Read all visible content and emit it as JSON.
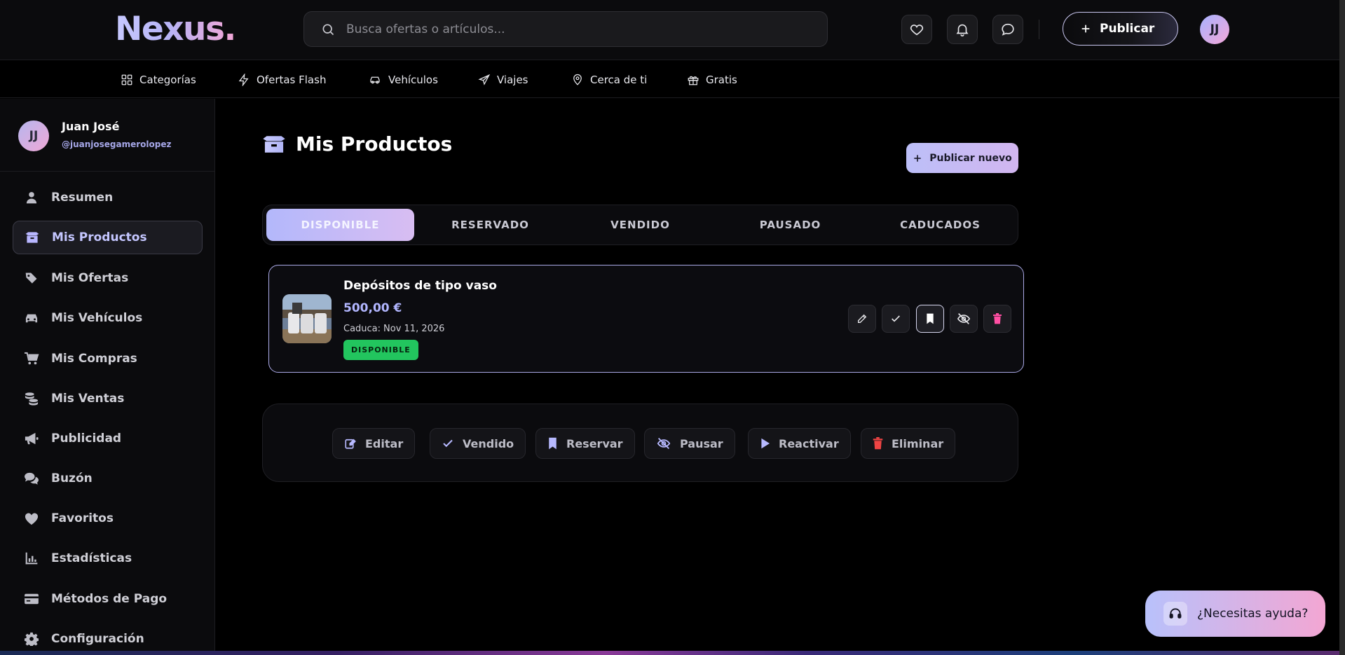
{
  "brand": {
    "logo": "Nexus."
  },
  "search": {
    "placeholder": "Busca ofertas o artículos..."
  },
  "header": {
    "publish_label": "Publicar",
    "avatar_initials": "JJ"
  },
  "categories": [
    {
      "label": "Categorías",
      "icon": "grid-icon"
    },
    {
      "label": "Ofertas Flash",
      "icon": "lightning-icon"
    },
    {
      "label": "Vehículos",
      "icon": "car-icon"
    },
    {
      "label": "Viajes",
      "icon": "plane-icon"
    },
    {
      "label": "Cerca de ti",
      "icon": "map-pin-icon"
    },
    {
      "label": "Gratis",
      "icon": "gift-icon"
    }
  ],
  "sidebar": {
    "user": {
      "initials": "JJ",
      "name": "Juan José",
      "handle": "@juanjosegamerolopez"
    },
    "items": [
      {
        "label": "Resumen",
        "icon": "user-icon"
      },
      {
        "label": "Mis Productos",
        "icon": "box-icon",
        "active": true
      },
      {
        "label": "Mis Ofertas",
        "icon": "tags-icon"
      },
      {
        "label": "Mis Vehículos",
        "icon": "car-icon"
      },
      {
        "label": "Mis Compras",
        "icon": "cart-icon"
      },
      {
        "label": "Mis Ventas",
        "icon": "coins-icon"
      },
      {
        "label": "Publicidad",
        "icon": "megaphone-icon"
      },
      {
        "label": "Buzón",
        "icon": "chat-icon"
      },
      {
        "label": "Favoritos",
        "icon": "heart-icon"
      },
      {
        "label": "Estadísticas",
        "icon": "chart-icon"
      },
      {
        "label": "Métodos de Pago",
        "icon": "card-icon"
      },
      {
        "label": "Configuración",
        "icon": "gear-icon"
      }
    ]
  },
  "main": {
    "title": "Mis Productos",
    "new_button": "Publicar nuevo",
    "tabs": [
      "DISPONIBLE",
      "RESERVADO",
      "VENDIDO",
      "PAUSADO",
      "CADUCADOS"
    ],
    "active_tab": "DISPONIBLE",
    "product": {
      "title": "Depósitos de tipo vaso",
      "price": "500,00 €",
      "expires_label": "Caduca:",
      "expires_date": "Nov 11, 2026",
      "status": "DISPONIBLE"
    },
    "bulk_actions": [
      "Editar",
      "Vendido",
      "Reservar",
      "Pausar",
      "Reactivar",
      "Eliminar"
    ]
  },
  "help": {
    "label": "¿Necesitas ayuda?"
  },
  "colors": {
    "accent": "#b3b8fb",
    "pink": "#f3a6d3",
    "success": "#22c55e",
    "danger": "#ef4444"
  }
}
